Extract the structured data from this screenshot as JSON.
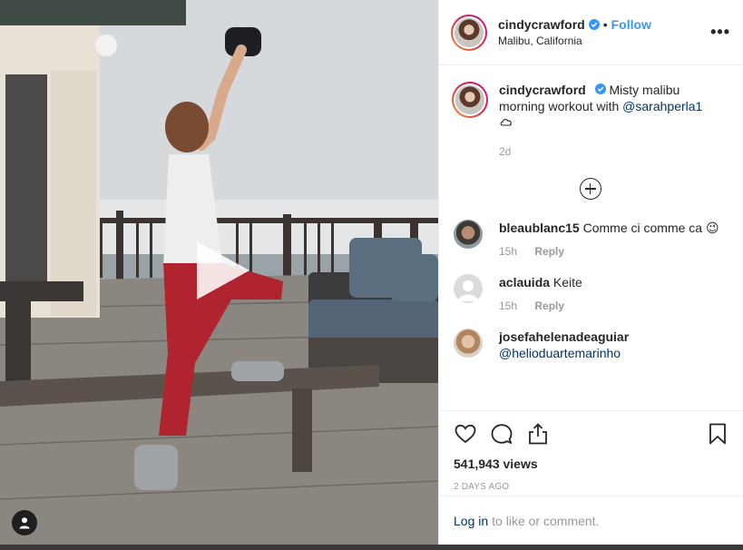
{
  "post": {
    "author": "cindycrawford",
    "follow_label": "Follow",
    "dot": "•",
    "location": "Malibu, California",
    "more_label": "•••"
  },
  "caption": {
    "author": "cindycrawford",
    "text": "Misty malibu morning workout with",
    "mention": "@sarahperla1",
    "time": "2d"
  },
  "comments": [
    {
      "author": "bleaublanc15",
      "text": "Comme ci comme ca",
      "emoji": "😉",
      "time": "15h",
      "reply_label": "Reply"
    },
    {
      "author": "aclauida",
      "text": "Keite",
      "time": "15h",
      "reply_label": "Reply"
    },
    {
      "author": "josefahelenadeaguiar",
      "mention": "@helioduartemarinho"
    }
  ],
  "actions": {
    "icons": [
      "heart-icon",
      "comment-icon",
      "share-icon",
      "bookmark-icon"
    ],
    "views": "541,943 views",
    "posted_ago": "2 DAYS AGO"
  },
  "login": {
    "link_label": "Log in",
    "text": "to like or comment."
  },
  "colors": {
    "accent": "#3897f0",
    "link": "#003569",
    "muted": "#999999"
  }
}
